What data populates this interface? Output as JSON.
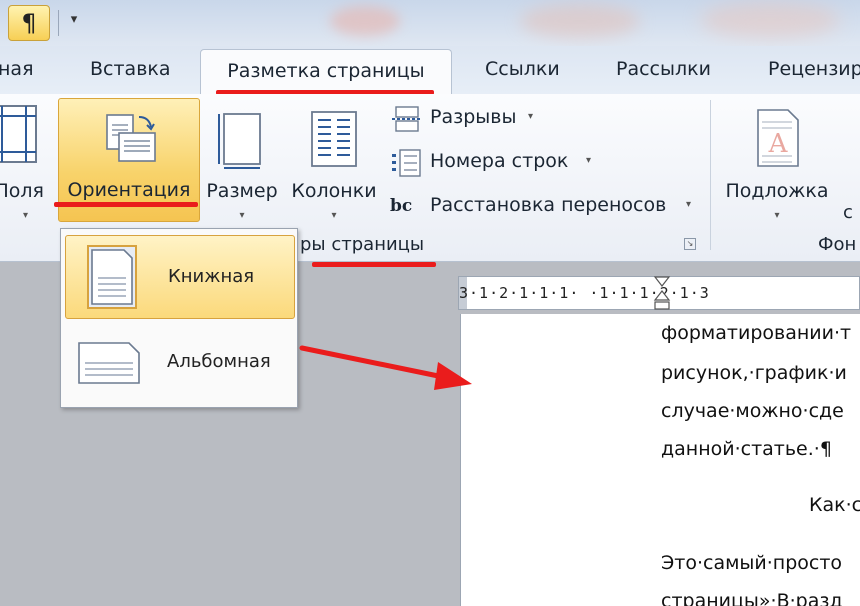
{
  "quick_access": {
    "pilcrow": "¶",
    "dropdown": "▾"
  },
  "tabs": {
    "home_partial": "ная",
    "insert": "Вставка",
    "page_layout": "Разметка страницы",
    "references": "Ссылки",
    "mailings": "Рассылки",
    "review_partial": "Рецензир"
  },
  "ribbon": {
    "margins_partial": "Поля",
    "orientation": "Ориентация",
    "size": "Размер",
    "columns": "Колонки",
    "breaks": "Разрывы",
    "line_numbers": "Номера строк",
    "hyphenation": "Расстановка переносов",
    "group_label_partial": "ры страницы",
    "watermark": "Подложка",
    "right_cut_text": "с",
    "background_group_partial": "Фон",
    "caret": "▾",
    "hyphen_icon_text": "bc"
  },
  "ruler": {
    "scale": "3·1·2·1·1·1·  ·1·1·1·2·1·3"
  },
  "orientation_menu": {
    "portrait": "Книжная",
    "landscape": "Альбомная"
  },
  "document": {
    "lines": [
      "форматировании·т",
      "рисунок,·график·и",
      "случае·можно·сде",
      "данной·статье.·¶",
      "Как·с",
      "Это·самый·просто",
      "страницы»·В·разд"
    ]
  },
  "colors": {
    "highlight_border": "#d7a23e",
    "annotation_red": "#ea1c1c",
    "ribbon_blue": "#2e5b9a"
  }
}
